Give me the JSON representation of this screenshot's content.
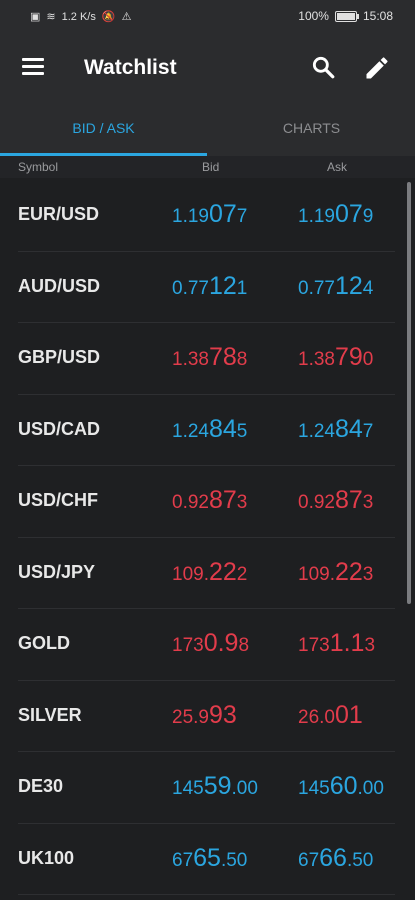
{
  "status": {
    "network": "1.2 K/s",
    "battery": "100%",
    "time": "15:08"
  },
  "header": {
    "title": "Watchlist"
  },
  "tabs": [
    {
      "label": "BID / ASK"
    },
    {
      "label": "CHARTS"
    }
  ],
  "columns": {
    "symbol": "Symbol",
    "bid": "Bid",
    "ask": "Ask"
  },
  "colors": {
    "up": "#2ba6e0",
    "down": "#e23c4b",
    "accent": "#2ba6e0"
  },
  "rows": [
    {
      "symbol": "EUR/USD",
      "dir": "up",
      "bid": {
        "a": "1.19",
        "b": "07",
        "c": "7"
      },
      "ask": {
        "a": "1.19",
        "b": "07",
        "c": "9"
      }
    },
    {
      "symbol": "AUD/USD",
      "dir": "up",
      "bid": {
        "a": "0.77",
        "b": "12",
        "c": "1"
      },
      "ask": {
        "a": "0.77",
        "b": "12",
        "c": "4"
      }
    },
    {
      "symbol": "GBP/USD",
      "dir": "down",
      "bid": {
        "a": "1.38",
        "b": "78",
        "c": "8"
      },
      "ask": {
        "a": "1.38",
        "b": "79",
        "c": "0"
      }
    },
    {
      "symbol": "USD/CAD",
      "dir": "up",
      "bid": {
        "a": "1.24",
        "b": "84",
        "c": "5"
      },
      "ask": {
        "a": "1.24",
        "b": "84",
        "c": "7"
      }
    },
    {
      "symbol": "USD/CHF",
      "dir": "down",
      "bid": {
        "a": "0.92",
        "b": "87",
        "c": "3"
      },
      "ask": {
        "a": "0.92",
        "b": "87",
        "c": "3"
      }
    },
    {
      "symbol": "USD/JPY",
      "dir": "down",
      "bid": {
        "a": "109.",
        "b": "22",
        "c": "2"
      },
      "ask": {
        "a": "109.",
        "b": "22",
        "c": "3"
      }
    },
    {
      "symbol": "GOLD",
      "dir": "down",
      "bid": {
        "a": "173",
        "b": "0.9",
        "c": "8"
      },
      "ask": {
        "a": "173",
        "b": "1.1",
        "c": "3"
      }
    },
    {
      "symbol": "SILVER",
      "dir": "down",
      "bid": {
        "a": "25.9",
        "b": "93",
        "c": ""
      },
      "ask": {
        "a": "26.0",
        "b": "01",
        "c": ""
      }
    },
    {
      "symbol": "DE30",
      "dir": "up",
      "bid": {
        "a": "145",
        "b": "59",
        "c": ".00"
      },
      "ask": {
        "a": "145",
        "b": "60",
        "c": ".00"
      }
    },
    {
      "symbol": "UK100",
      "dir": "up",
      "bid": {
        "a": "67",
        "b": "65",
        "c": ".50"
      },
      "ask": {
        "a": "67",
        "b": "66",
        "c": ".50"
      }
    }
  ]
}
